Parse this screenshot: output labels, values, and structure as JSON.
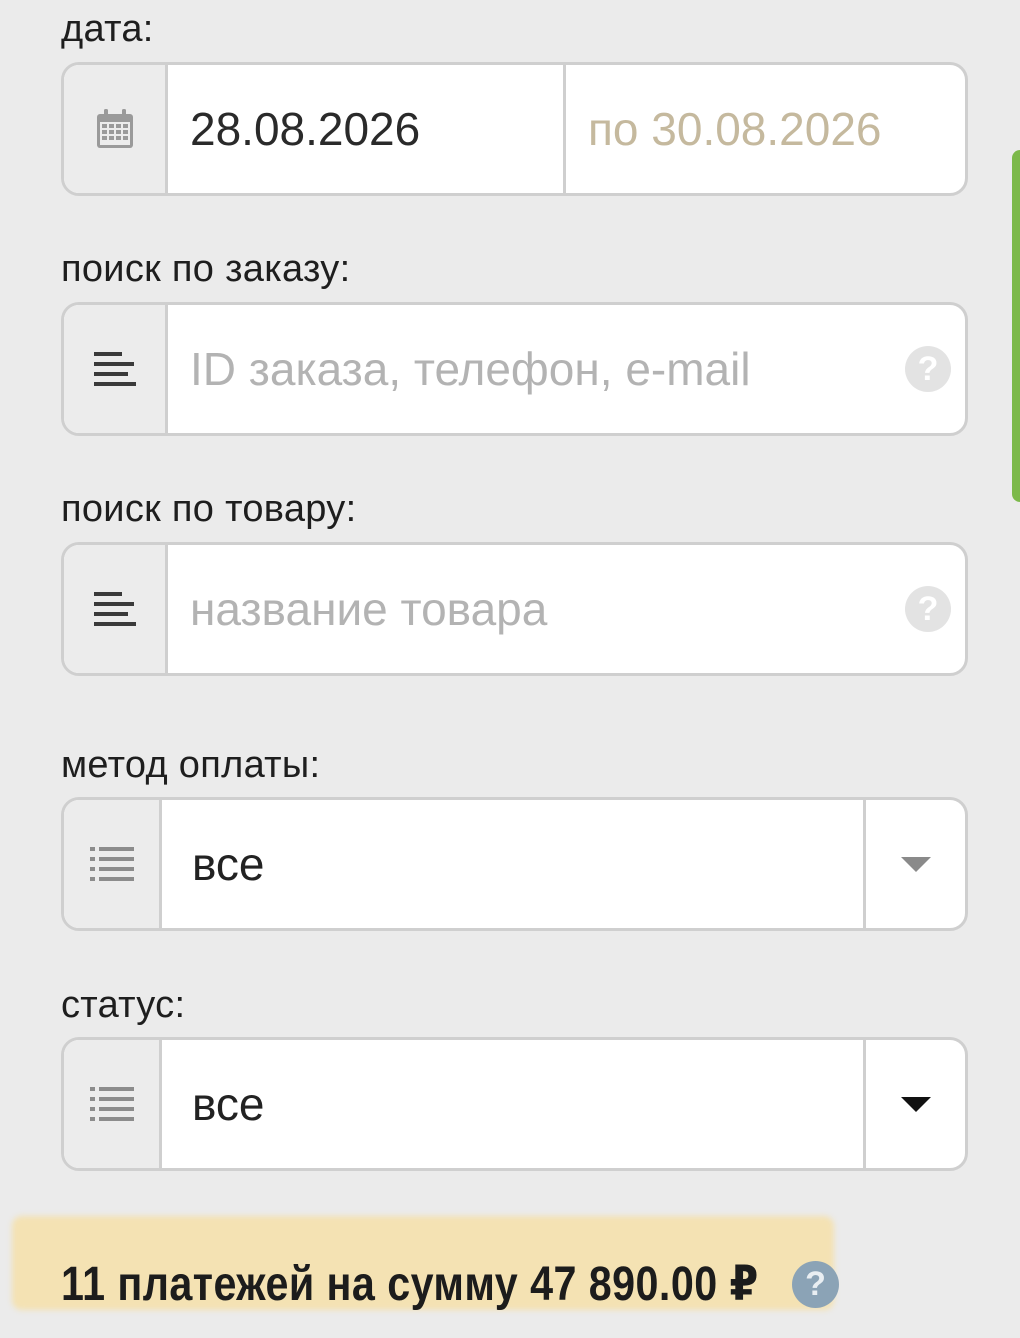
{
  "date": {
    "label": "дата:",
    "from": "28.08.2026",
    "to": "по 30.08.2026",
    "icon": "calendar-icon"
  },
  "order_search": {
    "label": "поиск по заказу:",
    "placeholder": "ID заказа, телефон, e-mail",
    "icon": "align-left-icon",
    "help": "?"
  },
  "product_search": {
    "label": "поиск по товару:",
    "placeholder": "название товара",
    "icon": "align-left-icon",
    "help": "?"
  },
  "payment_method": {
    "label": "метод оплаты:",
    "value": "все",
    "icon": "list-icon"
  },
  "status": {
    "label": "статус:",
    "value": "все",
    "icon": "list-icon"
  },
  "summary": {
    "text": "11 платежей на сумму 47 890.00 ₽",
    "help": "?"
  },
  "colors": {
    "highlight": "#ffd66e",
    "accent_green": "#7cb94a",
    "help_blue": "#8ba3b6"
  }
}
